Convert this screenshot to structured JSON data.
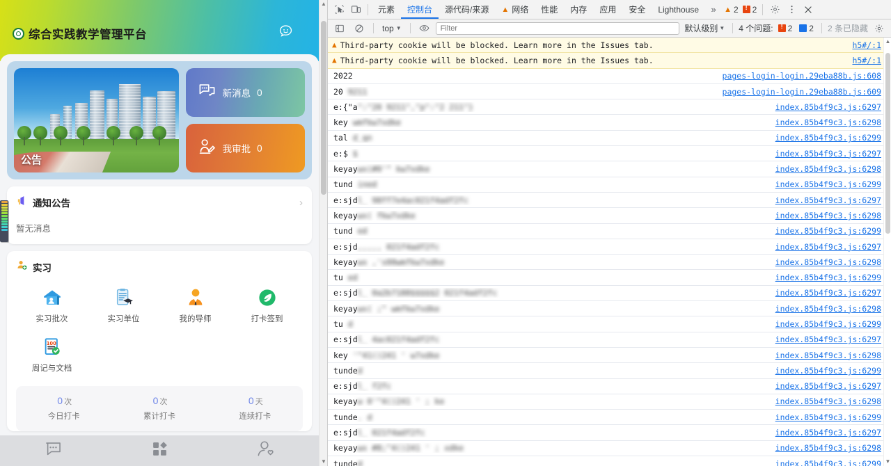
{
  "phone": {
    "header": {
      "title": "综合实践教学管理平台",
      "logo_icon": "school-crest-icon",
      "smiley_icon": "smiley-chat-icon"
    },
    "banner": {
      "hero_label": "公告",
      "hero_icon": "city-park-photo",
      "tiles": [
        {
          "label": "新消息",
          "count": "0",
          "icon": "message-bubble-icon"
        },
        {
          "label": "我审批",
          "count": "0",
          "icon": "approval-stamp-icon"
        }
      ]
    },
    "notice": {
      "title": "通知公告",
      "icon": "megaphone-icon",
      "chevron_icon": "chevron-right-icon",
      "empty_text": "暂无消息"
    },
    "intern": {
      "title": "实习",
      "icon": "user-add-icon",
      "items": [
        {
          "label": "实习批次",
          "icon": "batch-house-icon"
        },
        {
          "label": "实习单位",
          "icon": "clipboard-graduation-icon"
        },
        {
          "label": "我的导师",
          "icon": "mentor-person-icon"
        },
        {
          "label": "打卡签到",
          "icon": "leaf-checkin-icon"
        },
        {
          "label": "周记与文档",
          "icon": "score-document-icon"
        }
      ],
      "stats": [
        {
          "value": "0",
          "unit": "次",
          "label": "今日打卡"
        },
        {
          "value": "0",
          "unit": "次",
          "label": "累计打卡"
        },
        {
          "value": "0",
          "unit": "天",
          "label": "连续打卡"
        }
      ]
    },
    "tabbar": [
      {
        "icon": "chat-bubble-icon",
        "name": "tab-messages"
      },
      {
        "icon": "grid-apps-icon",
        "name": "tab-apps"
      },
      {
        "icon": "person-heart-icon",
        "name": "tab-profile"
      }
    ]
  },
  "devtools": {
    "left_icons": [
      {
        "icon": "inspect-element-icon"
      },
      {
        "icon": "device-toolbar-icon"
      }
    ],
    "tabs": [
      {
        "label": "元素",
        "active": false,
        "warn": false
      },
      {
        "label": "控制台",
        "active": true,
        "warn": false
      },
      {
        "label": "源代码/来源",
        "active": false,
        "warn": false
      },
      {
        "label": "网络",
        "active": false,
        "warn": true
      },
      {
        "label": "性能",
        "active": false,
        "warn": false
      },
      {
        "label": "内存",
        "active": false,
        "warn": false
      },
      {
        "label": "应用",
        "active": false,
        "warn": false
      },
      {
        "label": "安全",
        "active": false,
        "warn": false
      },
      {
        "label": "Lighthouse",
        "active": false,
        "warn": false
      }
    ],
    "more_tabs_icon": "chevron-double-right-icon",
    "warning_count": "2",
    "error_count": "2",
    "settings_icon": "gear-icon",
    "menu_icon": "kebab-menu-icon",
    "close_icon": "close-icon",
    "toolbar": {
      "sidebar_icon": "console-sidebar-icon",
      "clear_icon": "clear-console-icon",
      "context": "top",
      "eye_icon": "live-expression-icon",
      "filter_placeholder": "Filter",
      "filter_value": "",
      "level": "默认级别",
      "issues_label": "4 个问题:",
      "issue_errors": "2",
      "issue_infos": "2",
      "hidden_label": "2 条已隐藏",
      "settings_icon": "console-settings-gear-icon"
    },
    "rows": [
      {
        "type": "warning",
        "text": "Third-party cookie will be blocked. Learn more in the Issues tab.",
        "source": "h5#/:1",
        "blur": false
      },
      {
        "type": "warning",
        "text": "Third-party cookie will be blocked. Learn more in the Issues tab.",
        "source": "h5#/:1",
        "blur": false
      },
      {
        "type": "log",
        "text": "2022   ",
        "source": "pages-login-login.29eba88b.js:608",
        "blur": true
      },
      {
        "type": "log",
        "text": "20    9211",
        "source": "pages-login-login.29eba88b.js:609",
        "blur": true
      },
      {
        "type": "log",
        "text": "e:{\"a\":\"20    9211\",\"p\":\"2     211\"}",
        "source": "index.85b4f9c3.js:6297",
        "blur": true
      },
      {
        "type": "log",
        "text": "key                wmfkw7xdke",
        "source": "index.85b4f9c3.js:6298",
        "blur": true
      },
      {
        "type": "log",
        "text": "tal        d_qn",
        "source": "index.85b4f9c3.js:6299",
        "blur": true
      },
      {
        "type": "log",
        "text": "e:$   $",
        "source": "index.85b4f9c3.js:6297",
        "blur": true
      },
      {
        "type": "log",
        "text": "keyaywx(#0'^      kw7xdke",
        "source": "index.85b4f9c3.js:6298",
        "blur": true
      },
      {
        "type": "log",
        "text": "tund  ined",
        "source": "index.85b4f9c3.js:6299",
        "blur": true
      },
      {
        "type": "log",
        "text": "e:sjdl_              98ff7e4ac021f4adf2fc",
        "source": "index.85b4f9c3.js:6297",
        "blur": true
      },
      {
        "type": "log",
        "text": "keyaywx(            fkw7xdke",
        "source": "index.85b4f9c3.js:6298",
        "blur": true
      },
      {
        "type": "log",
        "text": "tund    ed",
        "source": "index.85b4f9c3.js:6299",
        "blur": true
      },
      {
        "type": "log",
        "text": "e:sjd            ,,,,,      021f4adf2fc",
        "source": "index.85b4f9c3.js:6297",
        "blur": true
      },
      {
        "type": "log",
        "text": "keyaywx      ,'s00wmfkw7xdke",
        "source": "index.85b4f9c3.js:6298",
        "blur": true
      },
      {
        "type": "log",
        "text": "tu      ed",
        "source": "index.85b4f9c3.js:6299",
        "blur": true
      },
      {
        "type": "log",
        "text": "e:sjdl_       0a2b7188$$$$$2     021f4adf2fc",
        "source": "index.85b4f9c3.js:6297",
        "blur": true
      },
      {
        "type": "log",
        "text": "keyaywx(  ;^       wmfkw7xdke",
        "source": "index.85b4f9c3.js:6298",
        "blur": true
      },
      {
        "type": "log",
        "text": "tu      d",
        "source": "index.85b4f9c3.js:6299",
        "blur": true
      },
      {
        "type": "log",
        "text": "e:sjdl_                    4ac021f4adf2fc",
        "source": "index.85b4f9c3.js:6297",
        "blur": true
      },
      {
        "type": "log",
        "text": "key     '^41()241 '      w7xdke",
        "source": "index.85b4f9c3.js:6298",
        "blur": true
      },
      {
        "type": "log",
        "text": "tunde    d",
        "source": "index.85b4f9c3.js:6299",
        "blur": true
      },
      {
        "type": "log",
        "text": "e:sjdl_                          f2fc",
        "source": "index.85b4f9c3.js:6297",
        "blur": true
      },
      {
        "type": "log",
        "text": "keyayw   0'^4()241 ' ;       ke",
        "source": "index.85b4f9c3.js:6298",
        "blur": true
      },
      {
        "type": "log",
        "text": "tunde.   d",
        "source": "index.85b4f9c3.js:6299",
        "blur": true
      },
      {
        "type": "log",
        "text": "e:sjdl_                      021f4adf2fc",
        "source": "index.85b4f9c3.js:6297",
        "blur": true
      },
      {
        "type": "log",
        "text": "keyaywx #8;^4()241 ' ;      xdke",
        "source": "index.85b4f9c3.js:6298",
        "blur": true
      },
      {
        "type": "log",
        "text": "tunde    d",
        "source": "index.85b4f9c3.js:6299",
        "blur": true
      }
    ]
  },
  "colors": {
    "accent": "#1a73e8",
    "warning": "#e37400",
    "error": "#e8440f",
    "header_gradient_start": "#d7e017",
    "header_gradient_end": "#22b2e8",
    "tile_message": "#6079c9",
    "tile_approve": "#e07b36",
    "stat_value": "#6f86e8"
  }
}
